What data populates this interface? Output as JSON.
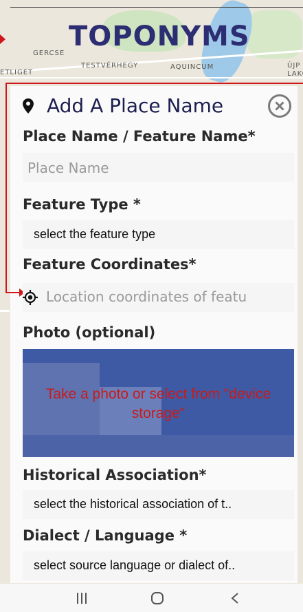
{
  "app": {
    "logo": "TOPONYMS"
  },
  "map_labels": [
    "GERCSE",
    "TESTVÉRHEGY",
    "AQUINCUM",
    "ÚJP",
    "LAKÓ",
    "ETLIGET"
  ],
  "form": {
    "title": "Add A Place Name",
    "place_name": {
      "label": "Place Name / Feature Name*",
      "placeholder": "Place Name"
    },
    "feature_type": {
      "label": "Feature Type *",
      "value": "select the feature type"
    },
    "coordinates": {
      "label": "Feature Coordinates*",
      "placeholder": "Location coordinates of featu"
    },
    "photo": {
      "label": "Photo (optional)",
      "prompt": "Take a photo or select from \"device storage\""
    },
    "historical": {
      "label": "Historical Association*",
      "value": "select the historical association of t.."
    },
    "dialect": {
      "label": "Dialect / Language *",
      "value": "select source language or dialect of.."
    }
  },
  "colors": {
    "accent": "#2c2d72",
    "annotation": "#d0161b",
    "photo_overlay": "#3f5aa4"
  },
  "nav": {
    "recent": "|||",
    "home": "○",
    "back": "<"
  }
}
